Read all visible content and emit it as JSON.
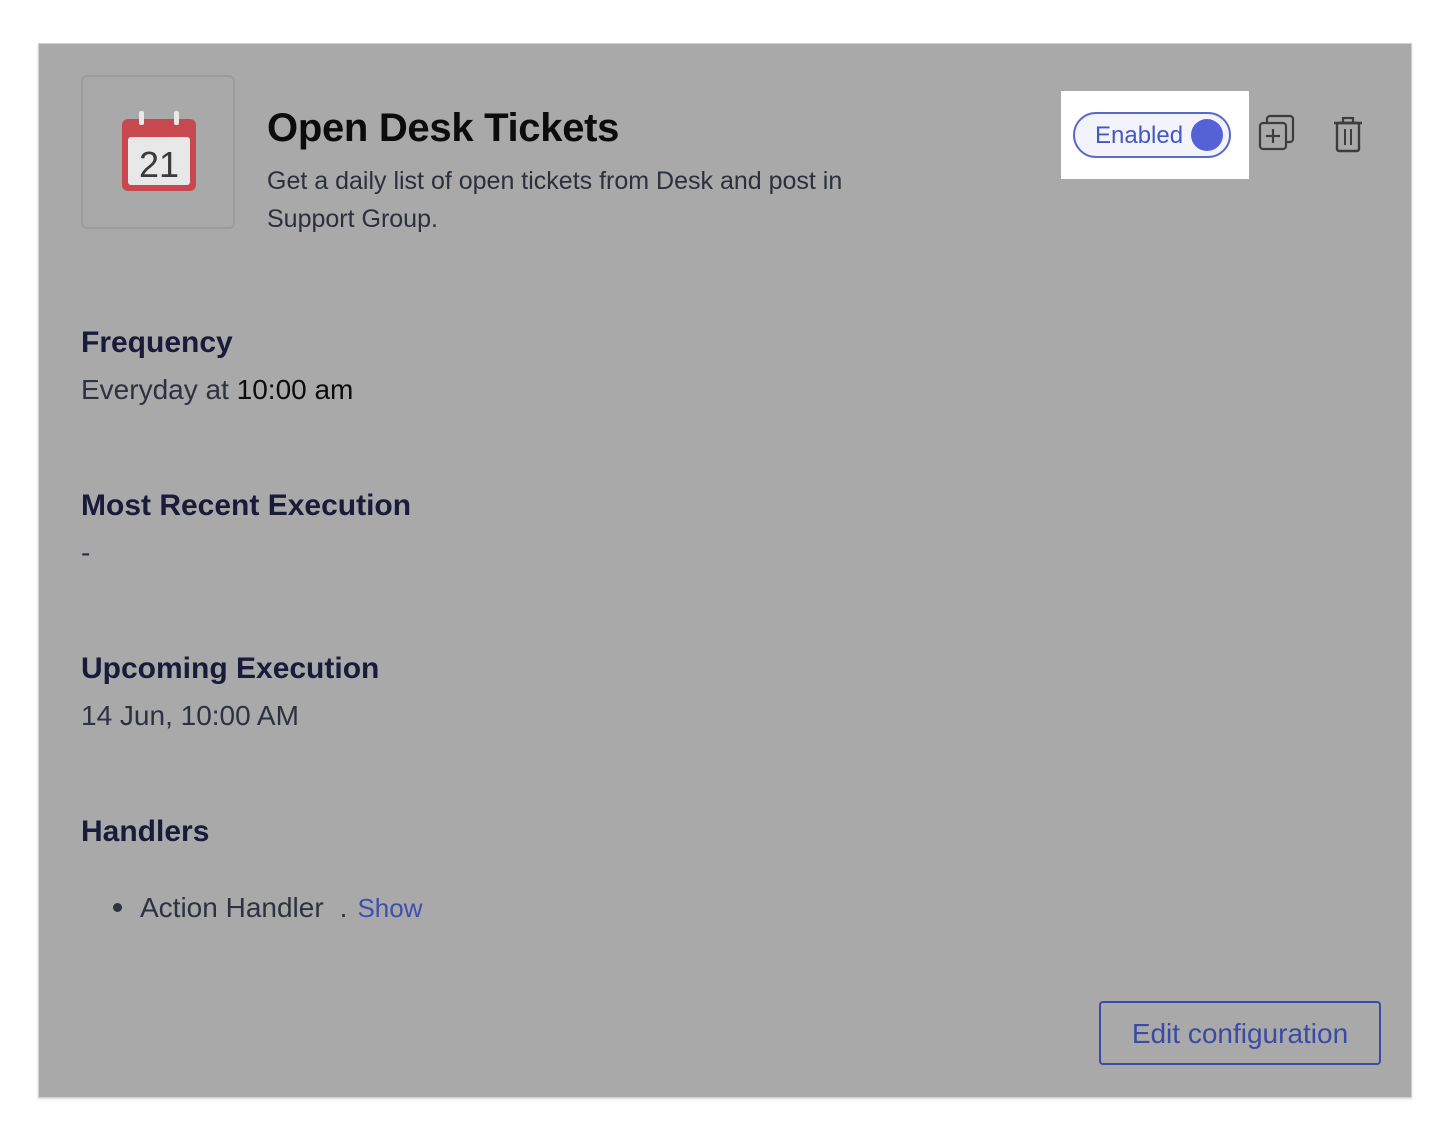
{
  "schedule": {
    "icon": "calendar-icon",
    "icon_day": "21",
    "title": "Open Desk Tickets",
    "description": "Get a daily list of open tickets from Desk and post in Support Group."
  },
  "toggle": {
    "label": "Enabled",
    "state": "on",
    "accent": "#5462d6"
  },
  "actions": {
    "duplicate_icon": "duplicate-icon",
    "delete_icon": "trash-icon"
  },
  "frequency": {
    "title": "Frequency",
    "prefix": "Everyday at",
    "time": "10:00 am"
  },
  "recent_execution": {
    "title": "Most Recent Execution",
    "value": "-"
  },
  "upcoming_execution": {
    "title": "Upcoming Execution",
    "value": "14 Jun, 10:00 AM"
  },
  "handlers": {
    "title": "Handlers",
    "items": [
      {
        "name": "Action Handler",
        "separator": ".",
        "link": "Show"
      }
    ]
  },
  "footer": {
    "edit_label": "Edit configuration"
  }
}
